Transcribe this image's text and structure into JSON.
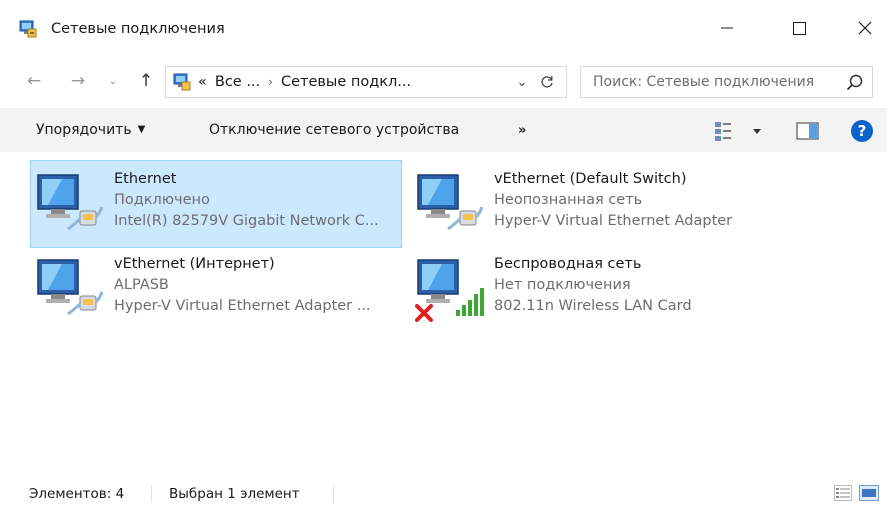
{
  "window": {
    "title": "Сетевые подключения",
    "icon": "network-connections-icon"
  },
  "navigation": {
    "breadcrumb": [
      "«",
      "Все ...",
      "Сетевые подкл..."
    ],
    "search_placeholder": "Поиск: Сетевые подключения"
  },
  "toolbar": {
    "organize_label": "Упорядочить",
    "disable_label": "Отключение сетевого устройства",
    "more_label": "»"
  },
  "connections": [
    {
      "name": "Ethernet",
      "status": "Подключено",
      "device": "Intel(R) 82579V Gigabit Network C...",
      "selected": true,
      "icon": "ethernet-adapter-icon"
    },
    {
      "name": "vEthernet (Default Switch)",
      "status": "Неопознанная сеть",
      "device": "Hyper-V Virtual Ethernet Adapter",
      "selected": false,
      "icon": "ethernet-adapter-icon"
    },
    {
      "name": "vEthernet (Интернет)",
      "status": "ALPASB",
      "device": "Hyper-V Virtual Ethernet Adapter ...",
      "selected": false,
      "icon": "ethernet-adapter-icon"
    },
    {
      "name": "Беспроводная сеть",
      "status": "Нет подключения",
      "device": "802.11n Wireless LAN Card",
      "selected": false,
      "icon": "wireless-adapter-disconnected-icon"
    }
  ],
  "statusbar": {
    "count_label": "Элементов: 4",
    "selected_label": "Выбран 1 элемент"
  },
  "colors": {
    "selection_bg": "#cce8ff",
    "selection_border": "#99d1ff",
    "secondary_text": "#6d6d6d",
    "help_blue": "#0a63c9",
    "toolbar_bg": "#f3f3f3"
  }
}
